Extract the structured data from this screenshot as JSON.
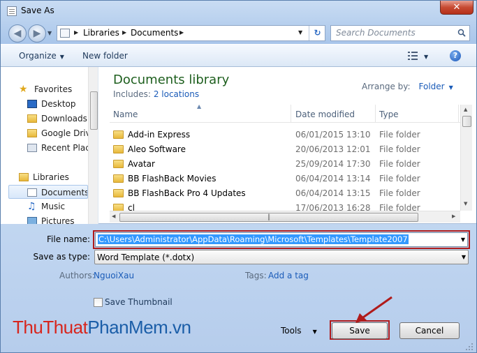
{
  "window": {
    "title": "Save As",
    "close_label": "✕",
    "accent": "#1a5bb8"
  },
  "nav": {
    "back_icon": "back-arrow-icon",
    "forward_icon": "forward-arrow-icon",
    "breadcrumb": [
      "Libraries",
      "Documents"
    ],
    "search_placeholder": "Search Documents"
  },
  "toolbar": {
    "organize_label": "Organize",
    "new_folder_label": "New folder"
  },
  "sidebar": {
    "favorites_label": "Favorites",
    "favorites": [
      "Desktop",
      "Downloads",
      "Google Drive",
      "Recent Places"
    ],
    "libraries_label": "Libraries",
    "libraries": [
      "Documents",
      "Music",
      "Pictures"
    ],
    "selected": "Documents"
  },
  "library": {
    "title": "Documents library",
    "includes_label": "Includes:",
    "includes_link": "2 locations",
    "arrange_label": "Arrange by:",
    "arrange_value": "Folder"
  },
  "columns": {
    "name": "Name",
    "date": "Date modified",
    "type": "Type"
  },
  "files": [
    {
      "name": "Add-in Express",
      "date": "06/01/2015 13:10",
      "type": "File folder"
    },
    {
      "name": "Aleo Software",
      "date": "20/06/2013 12:01",
      "type": "File folder"
    },
    {
      "name": "Avatar",
      "date": "25/09/2014 17:30",
      "type": "File folder"
    },
    {
      "name": "BB FlashBack Movies",
      "date": "06/04/2014 13:14",
      "type": "File folder"
    },
    {
      "name": "BB FlashBack Pro 4 Updates",
      "date": "06/04/2014 13:15",
      "type": "File folder"
    },
    {
      "name": "cl",
      "date": "17/06/2013 16:28",
      "type": "File folder"
    }
  ],
  "form": {
    "file_name_label": "File name:",
    "file_name_value": "C:\\Users\\Administrator\\AppData\\Roaming\\Microsoft\\Templates\\Template2007",
    "save_type_label": "Save as type:",
    "save_type_value": "Word Template (*.dotx)",
    "authors_label": "Authors:",
    "authors_value": "NguoiXau",
    "tags_label": "Tags:",
    "tags_value": "Add a tag",
    "thumbnail_label": "Save Thumbnail"
  },
  "footer": {
    "tools_label": "Tools",
    "save_label": "Save",
    "cancel_label": "Cancel"
  },
  "watermark": {
    "part1": "Thu",
    "part2": "Thuat",
    "part3": "Phan",
    "part4": "Mem",
    "part5": ".vn"
  },
  "highlight_color": "#b01b1b"
}
